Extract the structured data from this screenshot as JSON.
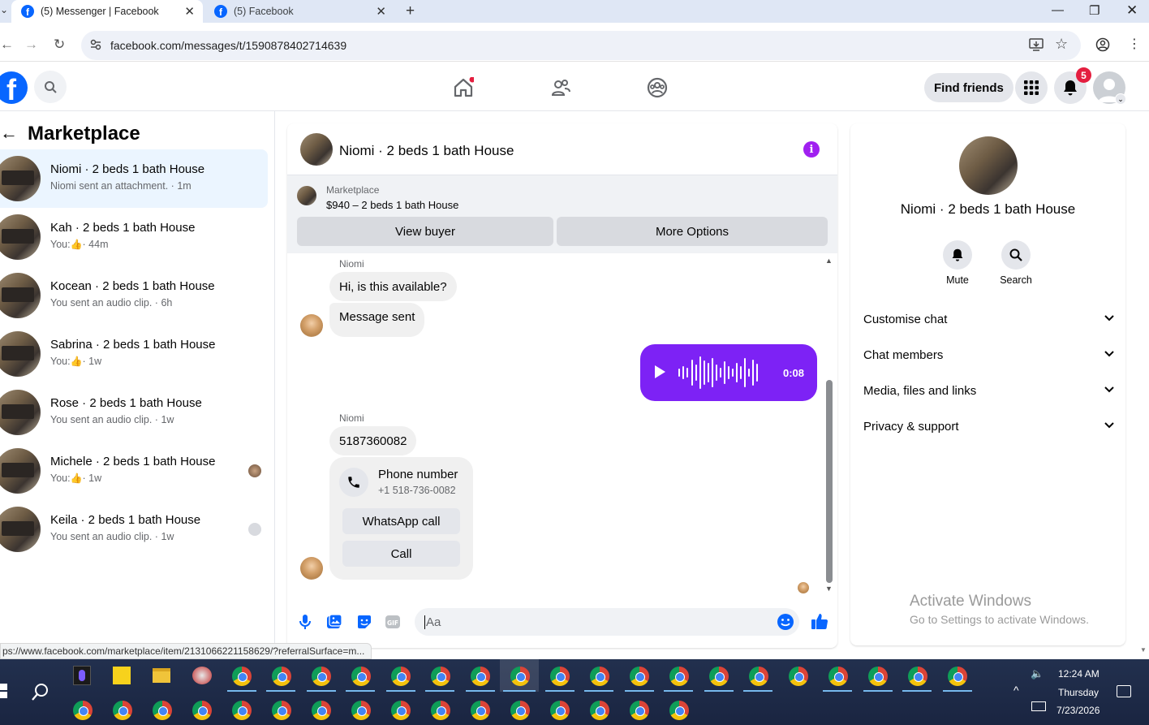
{
  "browser": {
    "tabs": [
      {
        "title": "(5) Messenger | Facebook"
      },
      {
        "title": "(5) Facebook"
      }
    ],
    "url": "facebook.com/messages/t/1590878402714639",
    "status_url": "ps://www.facebook.com/marketplace/item/2131066221158629/?referralSurface=m..."
  },
  "header": {
    "find_friends": "Find friends",
    "notifications_count": "5"
  },
  "sidebar": {
    "back_icon": "arrow-left-icon",
    "title": "Marketplace",
    "conversations": [
      {
        "name": "Niomi · 2 beds 1 bath House",
        "preview": "Niomi sent an attachment. · 1m",
        "active": true
      },
      {
        "name": "Kah · 2 beds 1 bath House",
        "preview_prefix": "You:",
        "preview_suffix": "· 44m"
      },
      {
        "name": "Kocean · 2 beds 1 bath House",
        "preview": "You sent an audio clip. · 6h"
      },
      {
        "name": "Sabrina · 2 beds 1 bath House",
        "preview_prefix": "You:",
        "preview_suffix": "· 1w"
      },
      {
        "name": "Rose · 2 beds 1 bath House",
        "preview": "You sent an audio clip. · 1w"
      },
      {
        "name": "Michele · 2 beds 1 bath House",
        "preview_prefix": "You:",
        "preview_suffix": "· 1w"
      },
      {
        "name": "Keila · 2 beds 1 bath House",
        "preview": "You sent an audio clip. · 1w"
      }
    ]
  },
  "chat": {
    "title": "Niomi · 2 beds 1 bath House",
    "marketplace_label": "Marketplace",
    "listing": "$940 – 2 beds 1 bath House",
    "view_buyer": "View buyer",
    "more_options": "More Options",
    "messages": {
      "sender1": "Niomi",
      "msg1": "Hi, is this available?",
      "msg2": "Message sent",
      "audio_duration": "0:08",
      "sender2": "Niomi",
      "msg3": "5187360082",
      "phone_title": "Phone number",
      "phone_number": "+1 518-736-0082",
      "whatsapp_call": "WhatsApp call",
      "call": "Call"
    },
    "composer_placeholder": "Aa"
  },
  "details": {
    "name": "Niomi · 2 beds 1 bath House",
    "mute": "Mute",
    "search": "Search",
    "sections": [
      "Customise chat",
      "Chat members",
      "Media, files and links",
      "Privacy & support"
    ]
  },
  "watermark": {
    "line1": "Activate Windows",
    "line2": "Go to Settings to activate Windows."
  },
  "taskbar": {
    "time": "12:24 AM",
    "day": "Thursday",
    "date": "7/23/2026"
  },
  "colors": {
    "accent": "#0866ff",
    "audio_bubble": "#7d22f5",
    "badge": "#e41e3f"
  }
}
